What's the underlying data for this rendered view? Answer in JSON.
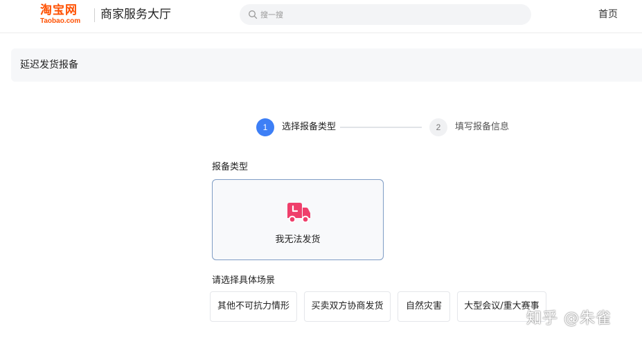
{
  "header": {
    "logo_cn": "淘宝网",
    "logo_en": "Taobao.com",
    "title": "商家服务大厅",
    "search_placeholder": "搜一搜",
    "search_value": "",
    "home_link": "首页",
    "brand_color": "#ff5000"
  },
  "page": {
    "title": "延迟发货报备"
  },
  "steps": [
    {
      "number": "1",
      "label": "选择报备类型",
      "active": true
    },
    {
      "number": "2",
      "label": "填写报备信息",
      "active": false
    }
  ],
  "type_section": {
    "label": "报备类型",
    "cards": [
      {
        "label": "我无法发货",
        "icon": "delivery-truck-icon",
        "selected": true
      }
    ]
  },
  "scene_section": {
    "label": "请选择具体场景",
    "options": [
      {
        "label": "其他不可抗力情形"
      },
      {
        "label": "买卖双方协商发货"
      },
      {
        "label": "自然灾害"
      },
      {
        "label": "大型会议/重大赛事"
      }
    ]
  },
  "watermark": "知乎 @朱雀",
  "colors": {
    "accent": "#3d7ff6",
    "truck_icon": "#ef3f6b",
    "card_border": "#7e9cc4"
  }
}
